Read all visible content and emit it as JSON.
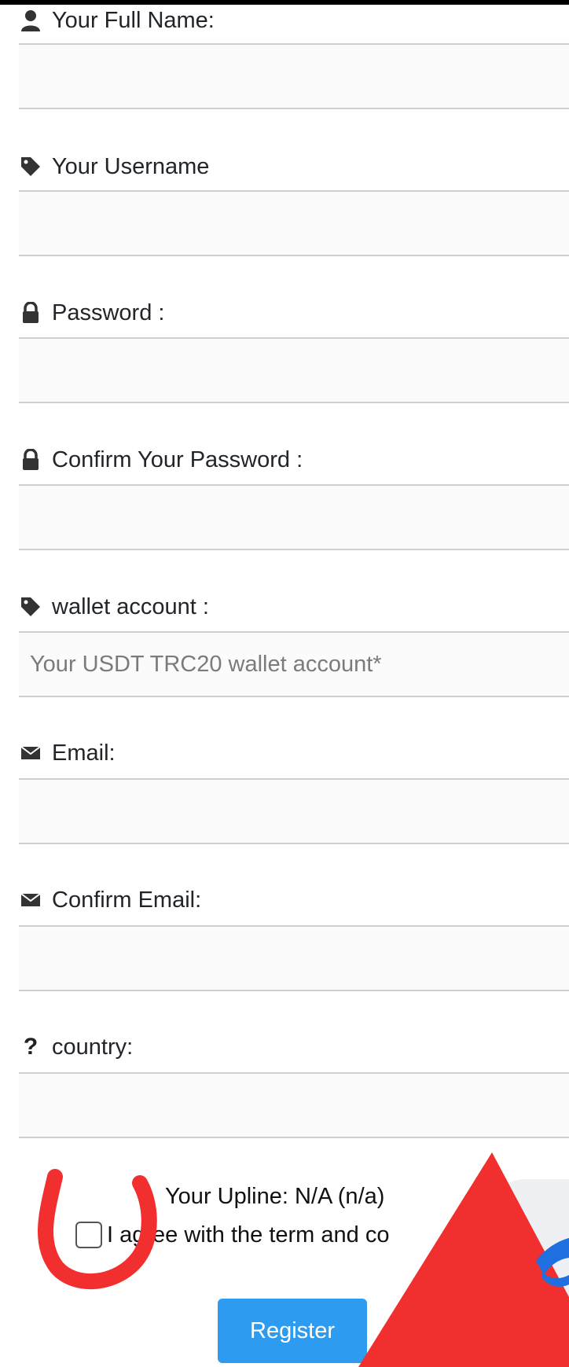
{
  "form": {
    "fields": [
      {
        "label": "Your Full Name:",
        "icon": "user-icon",
        "value": "",
        "placeholder": ""
      },
      {
        "label": "Your Username",
        "icon": "tag-icon",
        "value": "",
        "placeholder": ""
      },
      {
        "label": "Password :",
        "icon": "lock-icon",
        "value": "",
        "placeholder": ""
      },
      {
        "label": "Confirm Your Password :",
        "icon": "lock-icon",
        "value": "",
        "placeholder": ""
      },
      {
        "label": "wallet account :",
        "icon": "tag-icon",
        "value": "",
        "placeholder": "Your USDT TRC20 wallet account*"
      },
      {
        "label": "Email:",
        "icon": "envelope-icon",
        "value": "",
        "placeholder": ""
      },
      {
        "label": "Confirm Email:",
        "icon": "envelope-icon",
        "value": "",
        "placeholder": ""
      },
      {
        "label": "country:",
        "icon": "question-icon",
        "value": "",
        "placeholder": ""
      }
    ],
    "upline": "Your Upline: N/A (n/a)",
    "agree_label": "I agree with the term and co",
    "agree_checked": false,
    "register_label": "Register"
  },
  "colors": {
    "button": "#2d9bf0",
    "annotation_red": "#f12f2f",
    "text": "#212529",
    "input_border": "#cfcfcf"
  }
}
